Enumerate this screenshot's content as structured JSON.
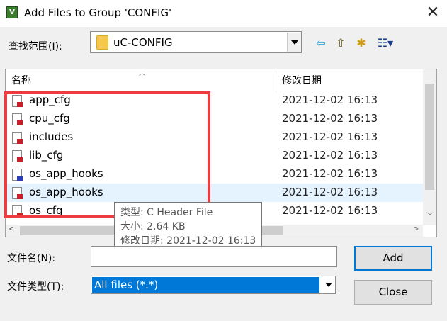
{
  "window": {
    "title": "Add Files to Group 'CONFIG'",
    "app_icon_glyph": "V",
    "close_glyph": "✕"
  },
  "lookin": {
    "label": "查找范围(I):",
    "value": "uC-CONFIG"
  },
  "toolbar": [
    {
      "name": "back-arrow-icon",
      "glyph": "⇦",
      "color": "#1e9bd7"
    },
    {
      "name": "up-folder-icon",
      "glyph": "⇧",
      "color": "#6b5a18"
    },
    {
      "name": "new-folder-icon",
      "glyph": "✱",
      "color": "#d19a1b"
    },
    {
      "name": "view-menu-icon",
      "glyph": "☷▾",
      "color": "#1b3f8f"
    }
  ],
  "columns": {
    "name": "名称",
    "date": "修改日期"
  },
  "files": [
    {
      "name": "app_cfg",
      "date": "2021-12-02 16:13",
      "icon": "header-file-icon",
      "badge": "red",
      "selected": false
    },
    {
      "name": "cpu_cfg",
      "date": "2021-12-02 16:13",
      "icon": "header-file-icon",
      "badge": "red",
      "selected": false
    },
    {
      "name": "includes",
      "date": "2021-12-02 16:13",
      "icon": "header-file-icon",
      "badge": "red",
      "selected": false
    },
    {
      "name": "lib_cfg",
      "date": "2021-12-02 16:13",
      "icon": "header-file-icon",
      "badge": "red",
      "selected": false
    },
    {
      "name": "os_app_hooks",
      "date": "2021-12-02 16:13",
      "icon": "c-source-file-icon",
      "badge": "blue",
      "selected": false
    },
    {
      "name": "os_app_hooks",
      "date": "2021-12-02 16:13",
      "icon": "header-file-icon",
      "badge": "red",
      "selected": true
    },
    {
      "name": "os_cfg",
      "date": "2021-12-02 16:13",
      "icon": "header-file-icon",
      "badge": "red",
      "selected": false
    }
  ],
  "tooltip": {
    "type": "类型: C Header File",
    "size": "大小: 2.64 KB",
    "modified": "修改日期: 2021-12-02 16:13"
  },
  "filename": {
    "label": "文件名(N):",
    "value": ""
  },
  "filetype": {
    "label": "文件类型(T):",
    "value": "All files (*.*)"
  },
  "buttons": {
    "add": "Add",
    "close": "Close"
  },
  "colors": {
    "highlight_box": "#ed3b40",
    "selection": "#0078d7",
    "row_hover": "#e5f3ff"
  }
}
